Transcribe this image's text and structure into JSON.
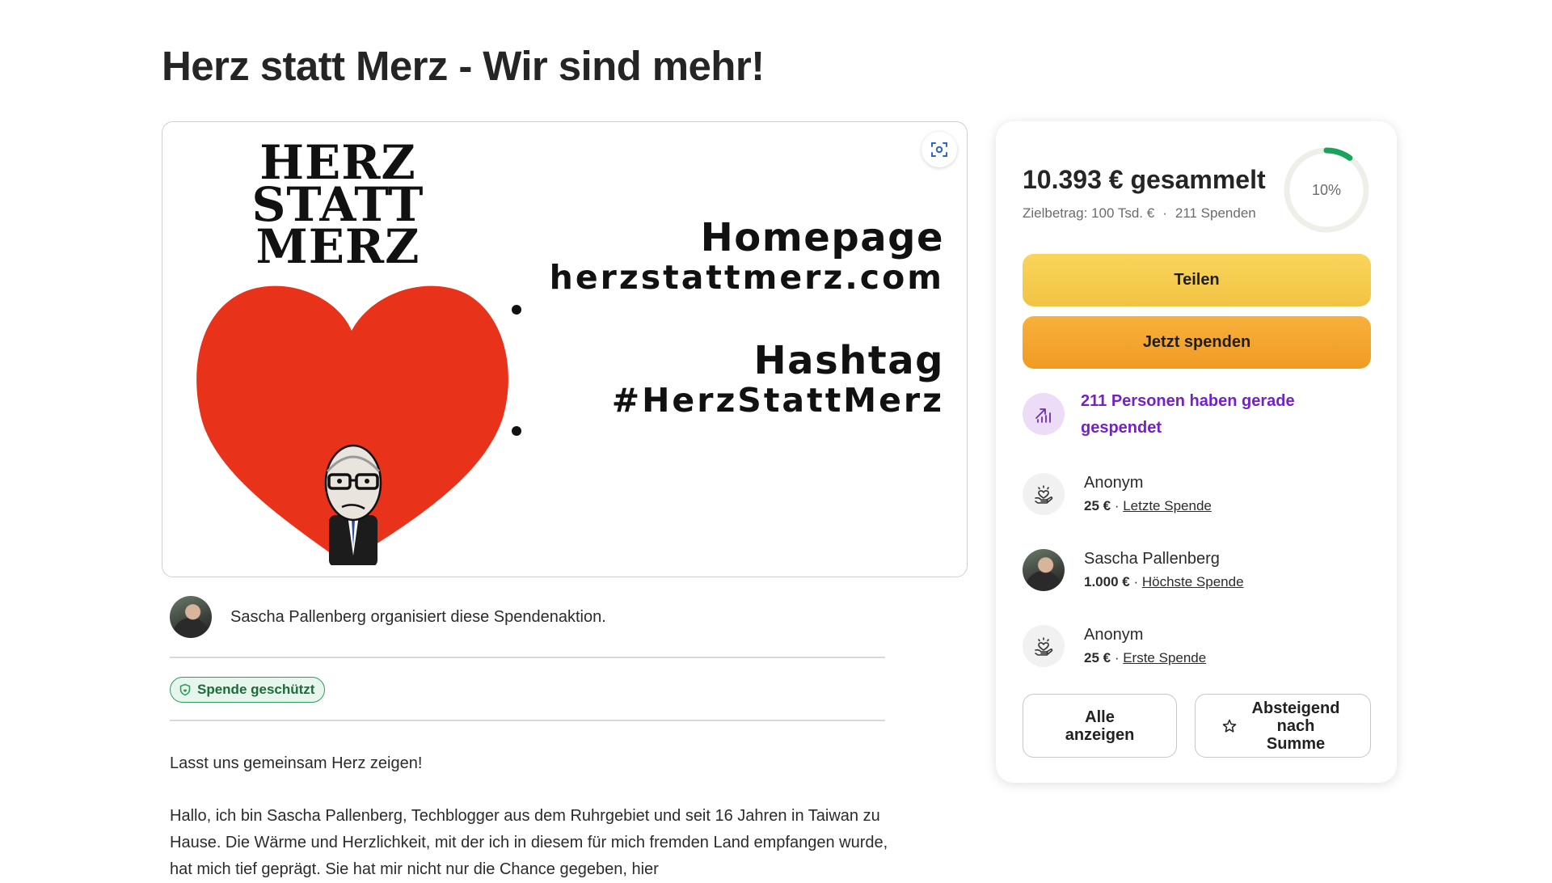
{
  "page": {
    "title": "Herz statt Merz - Wir sind mehr!"
  },
  "hero": {
    "logo_lines": [
      "HERZ",
      "STATT",
      "MERZ"
    ],
    "homepage_heading": "Homepage",
    "homepage_url": "herzstattmerz.com",
    "hashtag_heading": "Hashtag",
    "hashtag": "#HerzStattMerz",
    "heart_color": "#e8321a",
    "zoom_icon": "fullscreen-icon"
  },
  "organizer": {
    "text": "Sascha Pallenberg organisiert diese Spendenaktion."
  },
  "protection": {
    "label": "Spende geschützt",
    "color": "#2f9c5a"
  },
  "story": {
    "paragraphs": [
      "Lasst uns gemeinsam Herz zeigen!",
      "Hallo, ich bin Sascha Pallenberg, Techblogger aus dem Ruhrgebiet und seit 16 Jahren in Taiwan zu Hause. Die Wärme und Herzlichkeit, mit der ich in diesem für mich fremden Land empfangen wurde, hat mich tief geprägt. Sie hat mir nicht nur die Chance gegeben, hier"
    ]
  },
  "donation": {
    "raised": "10.393 € gesammelt",
    "goal": "Zielbetrag: 100 Tsd. €",
    "separator": "·",
    "count": "211 Spenden",
    "progress_label": "10%",
    "progress": 0.1,
    "progress_color": "#1aa35a",
    "share_label": "Teilen",
    "donate_label": "Jetzt spenden",
    "recent_text": "211 Personen haben gerade gespendet",
    "accent_purple": "#7421c9",
    "donors": [
      {
        "name": "Anonym",
        "amount": "25 €",
        "sep": " · ",
        "tag": "Letzte Spende",
        "icon": "heart-hand-icon"
      },
      {
        "name": "Sascha Pallenberg",
        "amount": "1.000 €",
        "sep": " · ",
        "tag": "Höchste Spende",
        "icon": "avatar"
      },
      {
        "name": "Anonym",
        "amount": "25 €",
        "sep": " · ",
        "tag": "Erste Spende",
        "icon": "heart-hand-icon"
      }
    ],
    "show_all_label": "Alle anzeigen",
    "sort_label": "Absteigend nach Summe"
  }
}
